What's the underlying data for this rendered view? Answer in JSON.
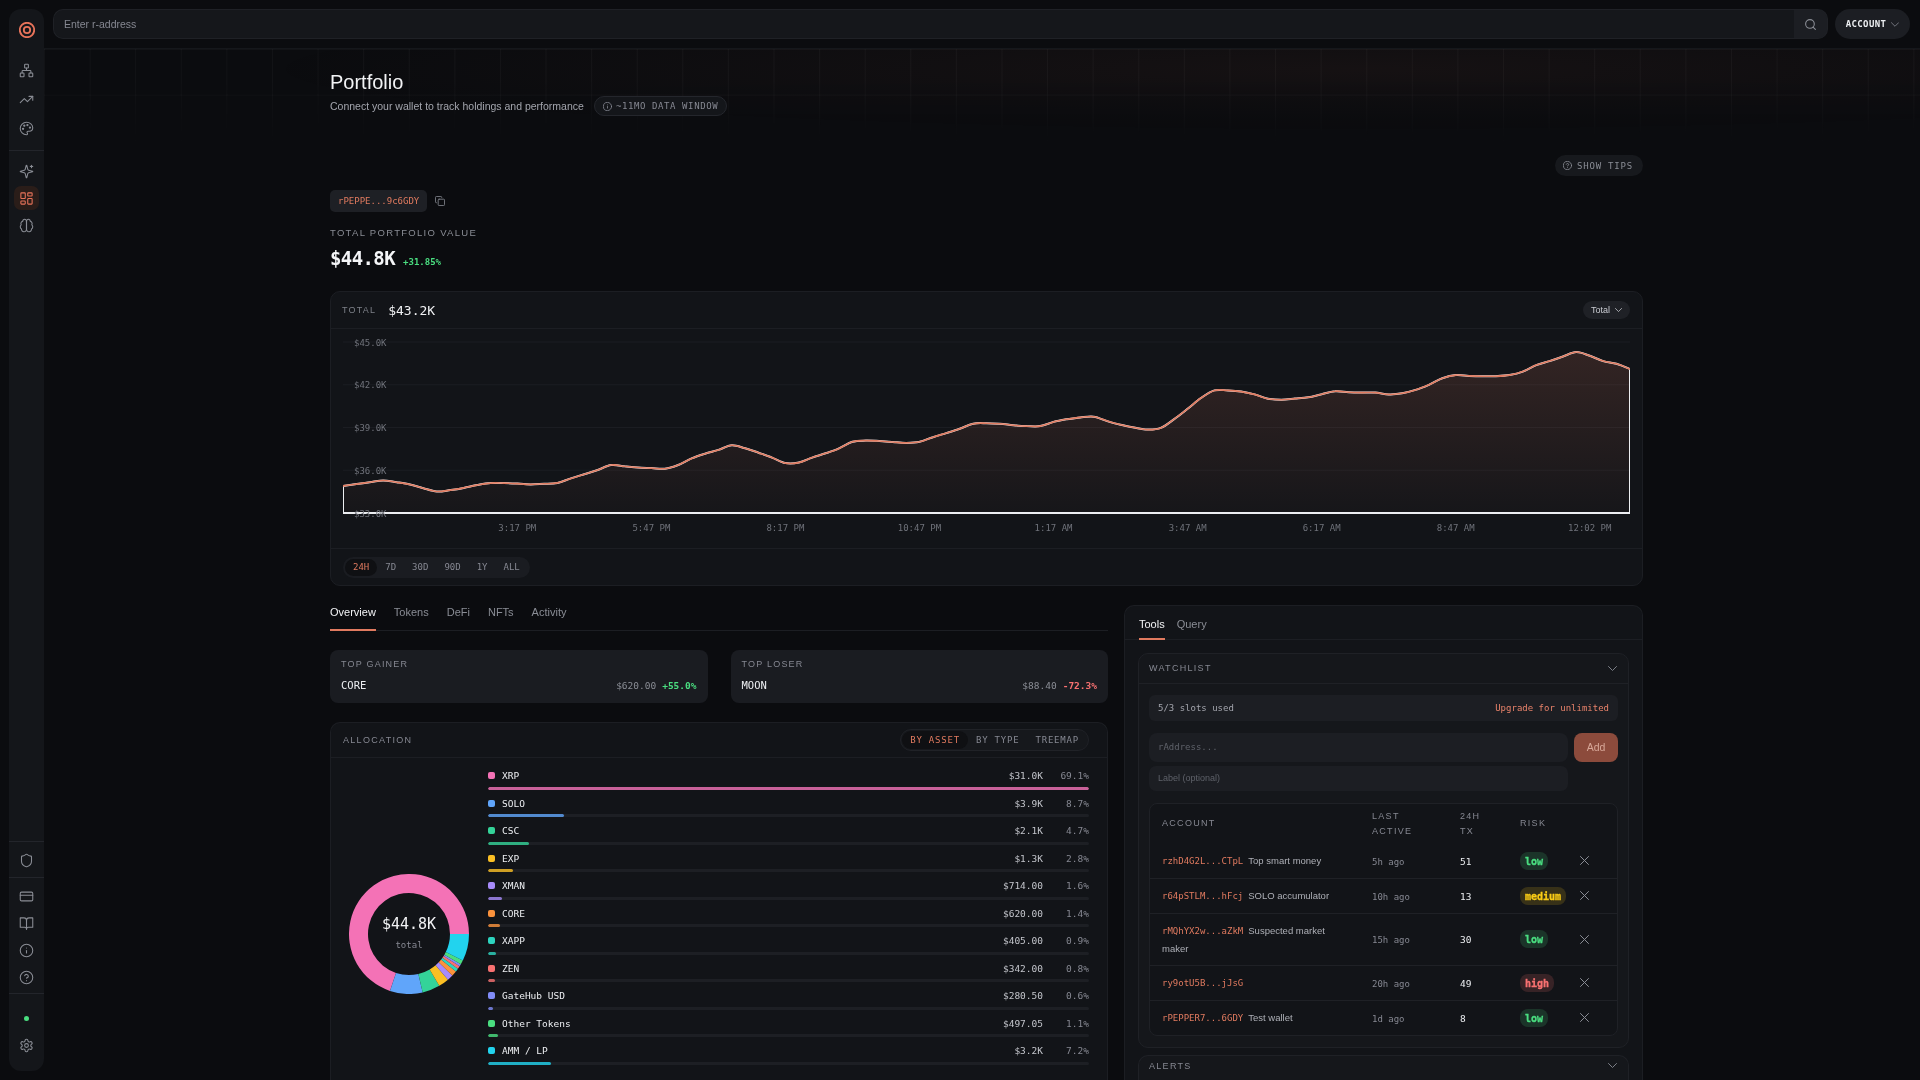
{
  "sidebar": {
    "top_groups": [
      {
        "items": [
          {
            "selected": false
          },
          {
            "selected": false
          },
          {
            "selected": false
          }
        ]
      },
      {
        "items": [
          {
            "selected": false
          },
          {
            "selected": true
          },
          {
            "selected": false
          }
        ]
      }
    ],
    "bottom_groups": [
      {
        "items": [
          {
            "selected": false
          }
        ]
      },
      {
        "items": [
          {
            "selected": false
          },
          {
            "selected": false
          },
          {
            "selected": false
          },
          {
            "selected": false
          }
        ]
      }
    ],
    "online": true,
    "settings": {
      "selected": false
    }
  },
  "topbar": {
    "search": {
      "placeholder": "Enter r-address"
    },
    "account_button": "ACCOUNT"
  },
  "page": {
    "title": "Portfolio",
    "subtitle": "Connect your wallet to track holdings and performance",
    "data_window": "~11MO DATA WINDOW",
    "show_tips_button": "SHOW TIPS"
  },
  "wallet": {
    "address": "rPEPPE...9c6GDY",
    "total_label": "TOTAL PORTFOLIO VALUE",
    "total_value": "$44.8K",
    "change": "+31.85%",
    "positive": true
  },
  "chart": {
    "total_label": "TOTAL",
    "total_value": "$43.2K",
    "chart_data": {
      "type": "area",
      "categories": [
        null,
        null,
        null,
        null,
        null,
        null,
        null,
        null,
        null,
        null,
        null,
        null,
        null,
        "3:17 PM",
        null,
        null,
        null,
        null,
        null,
        null,
        null,
        null,
        null,
        "5:47 PM",
        null,
        null,
        null,
        null,
        null,
        null,
        null,
        null,
        null,
        "8:17 PM",
        null,
        null,
        null,
        null,
        null,
        null,
        null,
        null,
        null,
        "10:47 PM",
        null,
        null,
        null,
        null,
        null,
        null,
        null,
        null,
        null,
        "1:17 AM",
        null,
        null,
        null,
        null,
        null,
        null,
        null,
        null,
        null,
        "3:47 AM",
        null,
        null,
        null,
        null,
        null,
        null,
        null,
        null,
        null,
        "6:17 AM",
        null,
        null,
        null,
        null,
        null,
        null,
        null,
        null,
        null,
        "8:47 AM",
        null,
        null,
        null,
        null,
        null,
        null,
        null,
        null,
        null,
        "12:02 PM",
        null,
        null,
        null
      ],
      "series": [
        {
          "name": "Total",
          "color": "#e07a5f",
          "values": [
            34.9,
            35.03,
            35.16,
            35.28,
            35.16,
            35.0,
            34.73,
            34.51,
            34.61,
            34.76,
            34.96,
            35.1,
            35.1,
            35.06,
            35.01,
            35.05,
            35.11,
            35.43,
            35.72,
            36.02,
            36.37,
            36.28,
            36.19,
            36.15,
            36.11,
            36.37,
            36.83,
            37.16,
            37.43,
            37.75,
            37.54,
            37.23,
            36.89,
            36.5,
            36.54,
            36.89,
            37.19,
            37.53,
            38.0,
            38.08,
            38.05,
            37.98,
            37.92,
            38.0,
            38.32,
            38.61,
            38.91,
            39.27,
            39.3,
            39.26,
            39.16,
            39.1,
            39.1,
            39.39,
            39.58,
            39.71,
            39.76,
            39.45,
            39.19,
            39.0,
            38.85,
            38.97,
            39.59,
            40.31,
            41.07,
            41.6,
            41.6,
            41.52,
            41.32,
            41.02,
            40.95,
            41.03,
            41.12,
            41.34,
            41.55,
            41.48,
            41.45,
            41.45,
            41.32,
            41.4,
            41.64,
            42.0,
            42.46,
            42.68,
            42.62,
            42.6,
            42.6,
            42.68,
            42.92,
            43.38,
            43.66,
            43.98,
            44.3,
            44.03,
            43.66,
            43.47,
            43.1
          ]
        }
      ],
      "ylim": [
        33,
        45
      ],
      "yticks": [
        {
          "value": 45,
          "label": "$45.0K"
        },
        {
          "value": 42,
          "label": "$42.0K"
        },
        {
          "value": 39,
          "label": "$39.0K"
        },
        {
          "value": 36,
          "label": "$36.0K"
        },
        {
          "value": 33,
          "label": "$33.0K"
        }
      ],
      "grid": true
    },
    "ranges": [
      {
        "label": "24H",
        "selected": true
      },
      {
        "label": "7D",
        "selected": false
      },
      {
        "label": "30D",
        "selected": false
      },
      {
        "label": "90D",
        "selected": false
      },
      {
        "label": "1Y",
        "selected": false
      },
      {
        "label": "ALL",
        "selected": false
      }
    ]
  },
  "tabs": [
    {
      "label": "Overview",
      "selected": true
    },
    {
      "label": "Tokens",
      "selected": false
    },
    {
      "label": "DeFi",
      "selected": false
    },
    {
      "label": "NFTs",
      "selected": false
    },
    {
      "label": "Activity",
      "selected": false
    }
  ],
  "highlights": [
    {
      "title": "TOP GAINER",
      "asset": "CORE",
      "price": "$620.00",
      "change": "+55.0%",
      "positive": true
    },
    {
      "title": "TOP LOSER",
      "asset": "MOON",
      "price": "$88.40",
      "change": "-72.3%",
      "positive": false
    }
  ],
  "allocation": {
    "title": "ALLOCATION",
    "views": [
      {
        "label": "BY ASSET",
        "selected": true
      },
      {
        "label": "BY TYPE",
        "selected": false
      },
      {
        "label": "TREEMAP",
        "selected": false
      }
    ],
    "donut": {
      "center_value": "$44.8K",
      "center_label": "total",
      "chart_data": {
        "type": "donut",
        "values": [
          69.1,
          8.7,
          4.7,
          2.8,
          1.6,
          1.4,
          0.9,
          0.8,
          0.6,
          1.1,
          7.2
        ]
      }
    },
    "rows": [
      {
        "name": "XRP",
        "color": "#f472b6",
        "value": "$31.0K",
        "share": "69.1%",
        "level": 1.0
      },
      {
        "name": "SOLO",
        "color": "#60a5fa",
        "value": "$3.9K",
        "share": "8.7%",
        "level": 0.126
      },
      {
        "name": "CSC",
        "color": "#34d399",
        "value": "$2.1K",
        "share": "4.7%",
        "level": 0.068
      },
      {
        "name": "EXP",
        "color": "#fbbf24",
        "value": "$1.3K",
        "share": "2.8%",
        "level": 0.041
      },
      {
        "name": "XMAN",
        "color": "#a78bfa",
        "value": "$714.00",
        "share": "1.6%",
        "level": 0.023
      },
      {
        "name": "CORE",
        "color": "#fb923c",
        "value": "$620.00",
        "share": "1.4%",
        "level": 0.02
      },
      {
        "name": "XAPP",
        "color": "#2dd4bf",
        "value": "$405.00",
        "share": "0.9%",
        "level": 0.013
      },
      {
        "name": "ZEN",
        "color": "#f87171",
        "value": "$342.00",
        "share": "0.8%",
        "level": 0.012
      },
      {
        "name": "GateHub USD",
        "color": "#818cf8",
        "value": "$280.50",
        "share": "0.6%",
        "level": 0.009
      },
      {
        "name": "Other Tokens",
        "color": "#4ade80",
        "value": "$497.05",
        "share": "1.1%",
        "level": 0.016
      },
      {
        "name": "AMM / LP",
        "color": "#22d3ee",
        "value": "$3.2K",
        "share": "7.2%",
        "level": 0.104
      }
    ]
  },
  "tools_panel": {
    "tabs": [
      {
        "label": "Tools",
        "selected": true
      },
      {
        "label": "Query",
        "selected": false
      }
    ],
    "watchlist": {
      "title": "WATCHLIST",
      "slots": "5/3 slots used",
      "upgrade_link": "Upgrade for unlimited",
      "address_field": {
        "placeholder": "rAddress..."
      },
      "label_field": {
        "placeholder": "Label (optional)"
      },
      "add_button": "Add",
      "columns": [
        "ACCOUNT",
        "LAST ACTIVE",
        "24H TX",
        "RISK"
      ],
      "rows": [
        {
          "address": "rzhD4G2L...CTpL",
          "label": "Top smart money",
          "last_active": "5h ago",
          "tx": "51",
          "risk": {
            "label": "low",
            "color": "#4ade80"
          }
        },
        {
          "address": "r64pSTLM...hFcj",
          "label": "SOLO accumulator",
          "last_active": "10h ago",
          "tx": "13",
          "risk": {
            "label": "medium",
            "color": "#facc15"
          }
        },
        {
          "address": "rMQhYX2w...aZkM",
          "label": "Suspected market maker",
          "last_active": "15h ago",
          "tx": "30",
          "risk": {
            "label": "low",
            "color": "#4ade80"
          }
        },
        {
          "address": "ry9otU5B...jJsG",
          "last_active": "20h ago",
          "tx": "49",
          "risk": {
            "label": "high",
            "color": "#f87171"
          }
        },
        {
          "address": "rPEPPER7...6GDY",
          "label": "Test wallet",
          "last_active": "1d ago",
          "tx": "8",
          "risk": {
            "label": "low",
            "color": "#4ade80"
          }
        }
      ]
    },
    "alerts": {
      "title": "ALERTS"
    }
  }
}
